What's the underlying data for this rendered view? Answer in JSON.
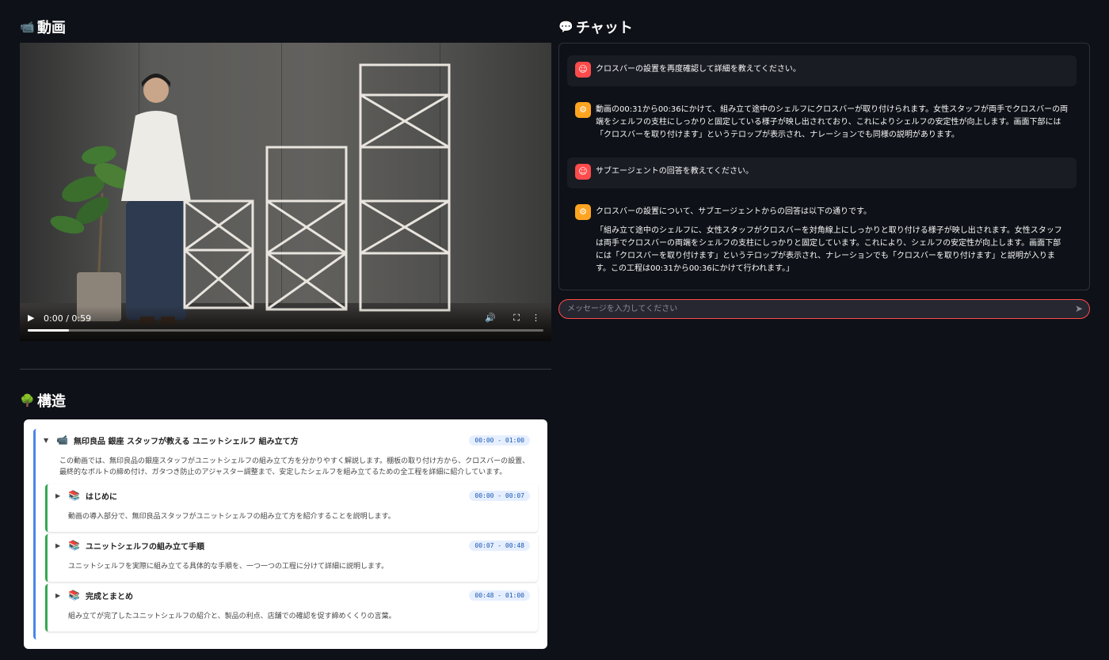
{
  "video_section": {
    "icon": "video-camera-icon",
    "title": "動画"
  },
  "video": {
    "time": "0:00 / 0:59",
    "progress": 0.08
  },
  "structure_section": {
    "icon": "tree-icon",
    "title": "構造"
  },
  "structure": {
    "root": {
      "title": "無印良品 銀座 スタッフが教える ユニットシェルフ 組み立て方",
      "time": "00:00 - 01:00",
      "description": "この動画では、無印良品の銀座スタッフがユニットシェルフの組み立て方を分かりやすく解説します。棚板の取り付け方から、クロスバーの設置、最終的なボルトの締め付け、ガタつき防止のアジャスター調整まで、安定したシェルフを組み立てるための全工程を詳細に紹介しています。",
      "children": [
        {
          "title": "はじめに",
          "time": "00:00 - 00:07",
          "description": "動画の導入部分で、無印良品スタッフがユニットシェルフの組み立て方を紹介することを説明します。"
        },
        {
          "title": "ユニットシェルフの組み立て手順",
          "time": "00:07 - 00:48",
          "description": "ユニットシェルフを実際に組み立てる具体的な手順を、一つ一つの工程に分けて詳細に説明します。"
        },
        {
          "title": "完成とまとめ",
          "time": "00:48 - 01:00",
          "description": "組み立てが完了したユニットシェルフの紹介と、製品の利点、店舗での確認を促す締めくくりの言葉。"
        }
      ]
    }
  },
  "chat_section": {
    "icon": "speech-bubble-icon",
    "title": "チャット"
  },
  "chat": {
    "messages": [
      {
        "role": "user",
        "text": "クロスバーの設置を再度確認して詳細を教えてください。"
      },
      {
        "role": "assistant",
        "text": "動画の00:31から00:36にかけて、組み立て途中のシェルフにクロスバーが取り付けられます。女性スタッフが両手でクロスバーの両端をシェルフの支柱にしっかりと固定している様子が映し出されており、これによりシェルフの安定性が向上します。画面下部には「クロスバーを取り付けます」というテロップが表示され、ナレーションでも同様の説明があります。"
      },
      {
        "role": "user",
        "text": "サブエージェントの回答を教えてください。"
      },
      {
        "role": "assistant",
        "text": "クロスバーの設置について、サブエージェントからの回答は以下の通りです。",
        "quote": "「組み立て途中のシェルフに、女性スタッフがクロスバーを対角線上にしっかりと取り付ける様子が映し出されます。女性スタッフは両手でクロスバーの両端をシェルフの支柱にしっかりと固定しています。これにより、シェルフの安定性が向上します。画面下部には「クロスバーを取り付けます」というテロップが表示され、ナレーションでも「クロスバーを取り付けます」と説明が入ります。この工程は00:31から00:36にかけて行われます。」"
      }
    ],
    "input_placeholder": "メッセージを入力してください"
  }
}
